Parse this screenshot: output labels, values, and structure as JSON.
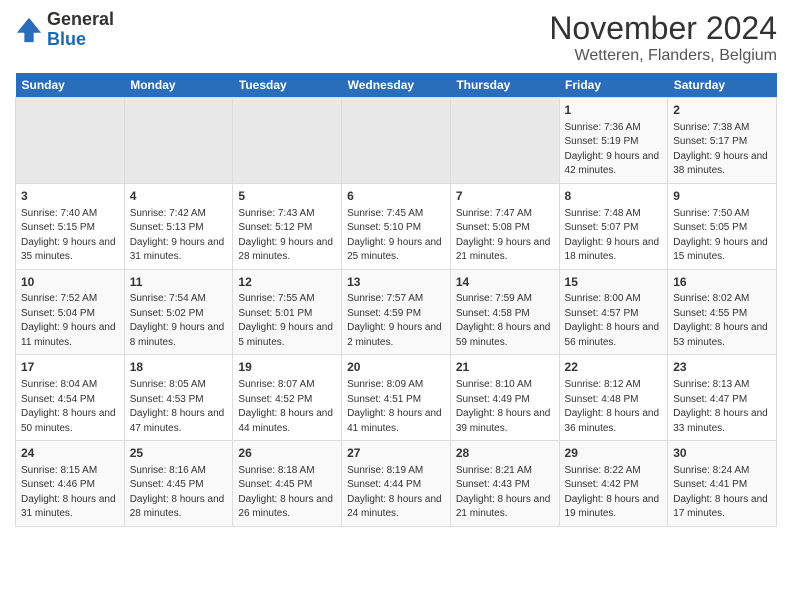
{
  "logo": {
    "line1": "General",
    "line2": "Blue"
  },
  "title": "November 2024",
  "subtitle": "Wetteren, Flanders, Belgium",
  "days_of_week": [
    "Sunday",
    "Monday",
    "Tuesday",
    "Wednesday",
    "Thursday",
    "Friday",
    "Saturday"
  ],
  "weeks": [
    [
      {
        "day": "",
        "sunrise": "",
        "sunset": "",
        "daylight": ""
      },
      {
        "day": "",
        "sunrise": "",
        "sunset": "",
        "daylight": ""
      },
      {
        "day": "",
        "sunrise": "",
        "sunset": "",
        "daylight": ""
      },
      {
        "day": "",
        "sunrise": "",
        "sunset": "",
        "daylight": ""
      },
      {
        "day": "",
        "sunrise": "",
        "sunset": "",
        "daylight": ""
      },
      {
        "day": "1",
        "sunrise": "Sunrise: 7:36 AM",
        "sunset": "Sunset: 5:19 PM",
        "daylight": "Daylight: 9 hours and 42 minutes."
      },
      {
        "day": "2",
        "sunrise": "Sunrise: 7:38 AM",
        "sunset": "Sunset: 5:17 PM",
        "daylight": "Daylight: 9 hours and 38 minutes."
      }
    ],
    [
      {
        "day": "3",
        "sunrise": "Sunrise: 7:40 AM",
        "sunset": "Sunset: 5:15 PM",
        "daylight": "Daylight: 9 hours and 35 minutes."
      },
      {
        "day": "4",
        "sunrise": "Sunrise: 7:42 AM",
        "sunset": "Sunset: 5:13 PM",
        "daylight": "Daylight: 9 hours and 31 minutes."
      },
      {
        "day": "5",
        "sunrise": "Sunrise: 7:43 AM",
        "sunset": "Sunset: 5:12 PM",
        "daylight": "Daylight: 9 hours and 28 minutes."
      },
      {
        "day": "6",
        "sunrise": "Sunrise: 7:45 AM",
        "sunset": "Sunset: 5:10 PM",
        "daylight": "Daylight: 9 hours and 25 minutes."
      },
      {
        "day": "7",
        "sunrise": "Sunrise: 7:47 AM",
        "sunset": "Sunset: 5:08 PM",
        "daylight": "Daylight: 9 hours and 21 minutes."
      },
      {
        "day": "8",
        "sunrise": "Sunrise: 7:48 AM",
        "sunset": "Sunset: 5:07 PM",
        "daylight": "Daylight: 9 hours and 18 minutes."
      },
      {
        "day": "9",
        "sunrise": "Sunrise: 7:50 AM",
        "sunset": "Sunset: 5:05 PM",
        "daylight": "Daylight: 9 hours and 15 minutes."
      }
    ],
    [
      {
        "day": "10",
        "sunrise": "Sunrise: 7:52 AM",
        "sunset": "Sunset: 5:04 PM",
        "daylight": "Daylight: 9 hours and 11 minutes."
      },
      {
        "day": "11",
        "sunrise": "Sunrise: 7:54 AM",
        "sunset": "Sunset: 5:02 PM",
        "daylight": "Daylight: 9 hours and 8 minutes."
      },
      {
        "day": "12",
        "sunrise": "Sunrise: 7:55 AM",
        "sunset": "Sunset: 5:01 PM",
        "daylight": "Daylight: 9 hours and 5 minutes."
      },
      {
        "day": "13",
        "sunrise": "Sunrise: 7:57 AM",
        "sunset": "Sunset: 4:59 PM",
        "daylight": "Daylight: 9 hours and 2 minutes."
      },
      {
        "day": "14",
        "sunrise": "Sunrise: 7:59 AM",
        "sunset": "Sunset: 4:58 PM",
        "daylight": "Daylight: 8 hours and 59 minutes."
      },
      {
        "day": "15",
        "sunrise": "Sunrise: 8:00 AM",
        "sunset": "Sunset: 4:57 PM",
        "daylight": "Daylight: 8 hours and 56 minutes."
      },
      {
        "day": "16",
        "sunrise": "Sunrise: 8:02 AM",
        "sunset": "Sunset: 4:55 PM",
        "daylight": "Daylight: 8 hours and 53 minutes."
      }
    ],
    [
      {
        "day": "17",
        "sunrise": "Sunrise: 8:04 AM",
        "sunset": "Sunset: 4:54 PM",
        "daylight": "Daylight: 8 hours and 50 minutes."
      },
      {
        "day": "18",
        "sunrise": "Sunrise: 8:05 AM",
        "sunset": "Sunset: 4:53 PM",
        "daylight": "Daylight: 8 hours and 47 minutes."
      },
      {
        "day": "19",
        "sunrise": "Sunrise: 8:07 AM",
        "sunset": "Sunset: 4:52 PM",
        "daylight": "Daylight: 8 hours and 44 minutes."
      },
      {
        "day": "20",
        "sunrise": "Sunrise: 8:09 AM",
        "sunset": "Sunset: 4:51 PM",
        "daylight": "Daylight: 8 hours and 41 minutes."
      },
      {
        "day": "21",
        "sunrise": "Sunrise: 8:10 AM",
        "sunset": "Sunset: 4:49 PM",
        "daylight": "Daylight: 8 hours and 39 minutes."
      },
      {
        "day": "22",
        "sunrise": "Sunrise: 8:12 AM",
        "sunset": "Sunset: 4:48 PM",
        "daylight": "Daylight: 8 hours and 36 minutes."
      },
      {
        "day": "23",
        "sunrise": "Sunrise: 8:13 AM",
        "sunset": "Sunset: 4:47 PM",
        "daylight": "Daylight: 8 hours and 33 minutes."
      }
    ],
    [
      {
        "day": "24",
        "sunrise": "Sunrise: 8:15 AM",
        "sunset": "Sunset: 4:46 PM",
        "daylight": "Daylight: 8 hours and 31 minutes."
      },
      {
        "day": "25",
        "sunrise": "Sunrise: 8:16 AM",
        "sunset": "Sunset: 4:45 PM",
        "daylight": "Daylight: 8 hours and 28 minutes."
      },
      {
        "day": "26",
        "sunrise": "Sunrise: 8:18 AM",
        "sunset": "Sunset: 4:45 PM",
        "daylight": "Daylight: 8 hours and 26 minutes."
      },
      {
        "day": "27",
        "sunrise": "Sunrise: 8:19 AM",
        "sunset": "Sunset: 4:44 PM",
        "daylight": "Daylight: 8 hours and 24 minutes."
      },
      {
        "day": "28",
        "sunrise": "Sunrise: 8:21 AM",
        "sunset": "Sunset: 4:43 PM",
        "daylight": "Daylight: 8 hours and 21 minutes."
      },
      {
        "day": "29",
        "sunrise": "Sunrise: 8:22 AM",
        "sunset": "Sunset: 4:42 PM",
        "daylight": "Daylight: 8 hours and 19 minutes."
      },
      {
        "day": "30",
        "sunrise": "Sunrise: 8:24 AM",
        "sunset": "Sunset: 4:41 PM",
        "daylight": "Daylight: 8 hours and 17 minutes."
      }
    ]
  ]
}
